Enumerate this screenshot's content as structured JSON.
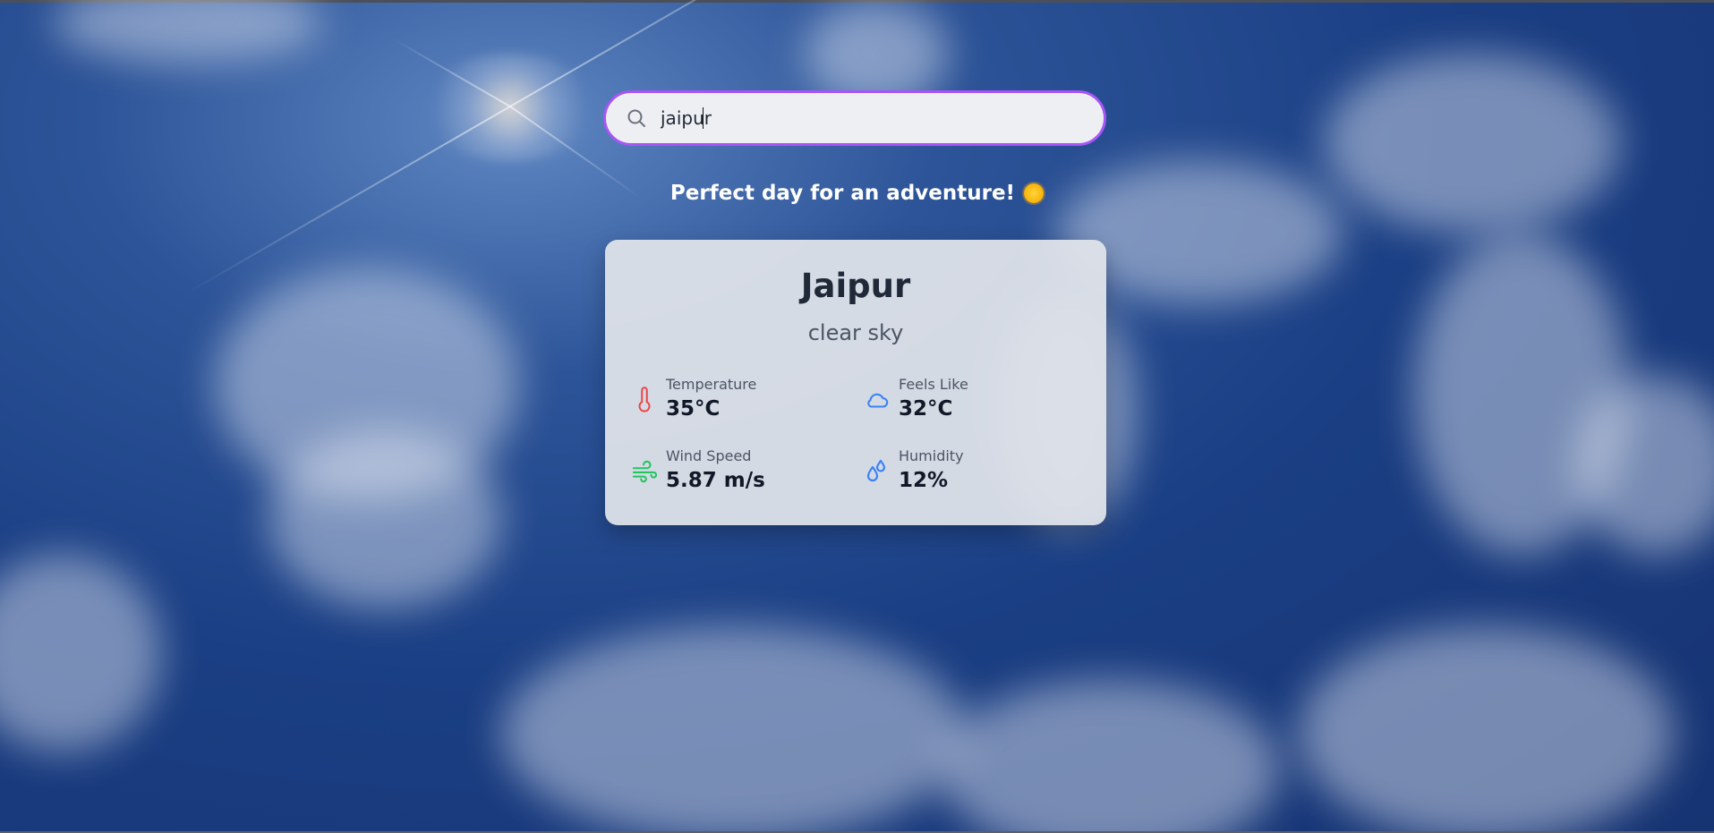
{
  "search": {
    "value": "jaipur",
    "accent_color": "#a855f7",
    "icon": "search-icon"
  },
  "tagline": {
    "text": "Perfect day for an adventure!",
    "emoji_icon": "sun-icon"
  },
  "weather": {
    "city": "Jaipur",
    "description": "clear sky",
    "stats": [
      {
        "label": "Temperature",
        "value": "35°C",
        "icon": "thermometer-icon",
        "color": "#ef4444"
      },
      {
        "label": "Feels Like",
        "value": "32°C",
        "icon": "cloud-icon",
        "color": "#3b82f6"
      },
      {
        "label": "Wind Speed",
        "value": "5.87 m/s",
        "icon": "wind-icon",
        "color": "#22c55e"
      },
      {
        "label": "Humidity",
        "value": "12%",
        "icon": "droplets-icon",
        "color": "#3b82f6"
      }
    ]
  }
}
